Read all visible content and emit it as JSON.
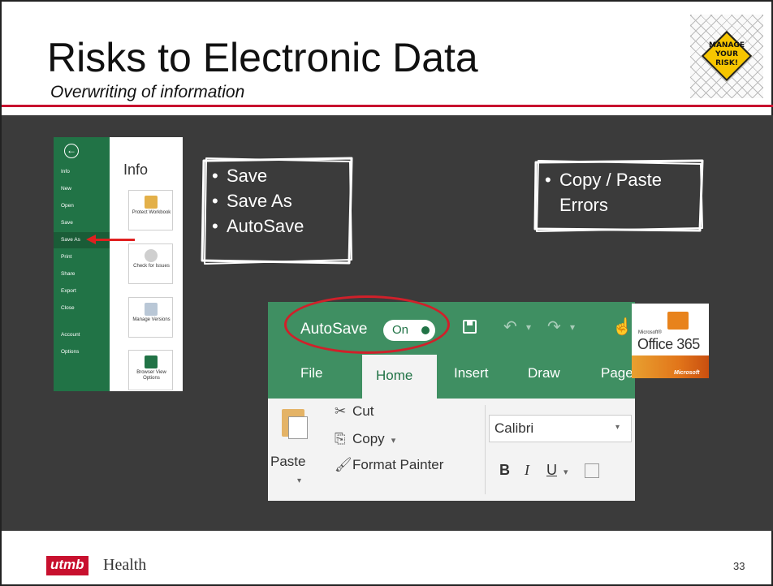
{
  "slide": {
    "title": "Risks to Electronic Data",
    "subtitle": "Overwriting of information",
    "page_number": "33",
    "accent_color": "#c8102e",
    "content_bg": "#3b3b3b"
  },
  "badge": {
    "text": "MANAGE YOUR RISK!"
  },
  "backstage": {
    "back_icon": "arrow-left-circle-icon",
    "nav": [
      "Info",
      "New",
      "Open",
      "Save",
      "Save As",
      "Print",
      "Share",
      "Export",
      "Close",
      "Account",
      "Options"
    ],
    "active_item": "Save As",
    "pane_title": "Info",
    "tiles": [
      "Protect Workbook",
      "Check for Issues",
      "Manage Versions",
      "Browser View Options"
    ]
  },
  "save_box": {
    "items": [
      "Save",
      "Save As",
      "AutoSave"
    ]
  },
  "copy_box": {
    "line1": "Copy / Paste",
    "line2": "Errors"
  },
  "ribbon": {
    "autosave_label": "AutoSave",
    "toggle_label": "On",
    "tabs": [
      "File",
      "Home",
      "Insert",
      "Draw",
      "Page"
    ],
    "active_tab": "Home",
    "paste_label": "Paste",
    "cut_label": "Cut",
    "copy_label": "Copy",
    "format_painter_label": "Format Painter",
    "font_name": "Calibri",
    "bold": "B",
    "italic": "I",
    "underline": "U",
    "theme_color": "#3f8f62"
  },
  "office365": {
    "ms_small": "Microsoft®",
    "name": "Office 365",
    "ms_band": "Microsoft"
  },
  "footer": {
    "brand": "utmb",
    "brand_suffix": "Health"
  }
}
